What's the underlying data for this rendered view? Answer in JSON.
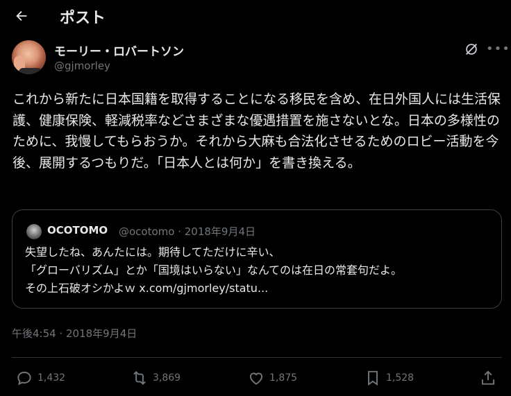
{
  "header": {
    "title": "ポスト"
  },
  "author": {
    "name": "モーリー・ロバートソン",
    "handle": "@gjmorley"
  },
  "post": {
    "text": "これから新たに日本国籍を取得することになる移民を含め、在日外国人には生活保護、健康保険、軽減税率などさまざまな優遇措置を施さないとな。日本の多様性のために、我慢してもらおうか。それから大麻も合法化させるためのロビー活動を今後、展開するつもりだ。「日本人とは何か」を書き換える。",
    "timestamp": "午後4:54 · 2018年9月4日"
  },
  "quote": {
    "name": "OCOTOMO",
    "meta": "@ocotomo · 2018年9月4日",
    "lines": [
      "失望したね、あんたには。期待してただけに辛い、",
      "「グローバリズム」とか「国境はいらない」なんてのは在日の常套句だよ。",
      "その上石破オシかよｗ x.com/gjmorley/statu..."
    ]
  },
  "stats": {
    "replies": "1,432",
    "reposts": "3,869",
    "likes": "1,875",
    "bookmarks": "1,528"
  },
  "colors": {
    "background": "#000000",
    "text": "#e7e9ea",
    "muted": "#71767b",
    "border": "#3a3f45"
  },
  "icons": [
    "back-arrow-icon",
    "grok-icon",
    "more-icon",
    "reply-icon",
    "repost-icon",
    "like-icon",
    "bookmark-icon",
    "share-icon"
  ]
}
